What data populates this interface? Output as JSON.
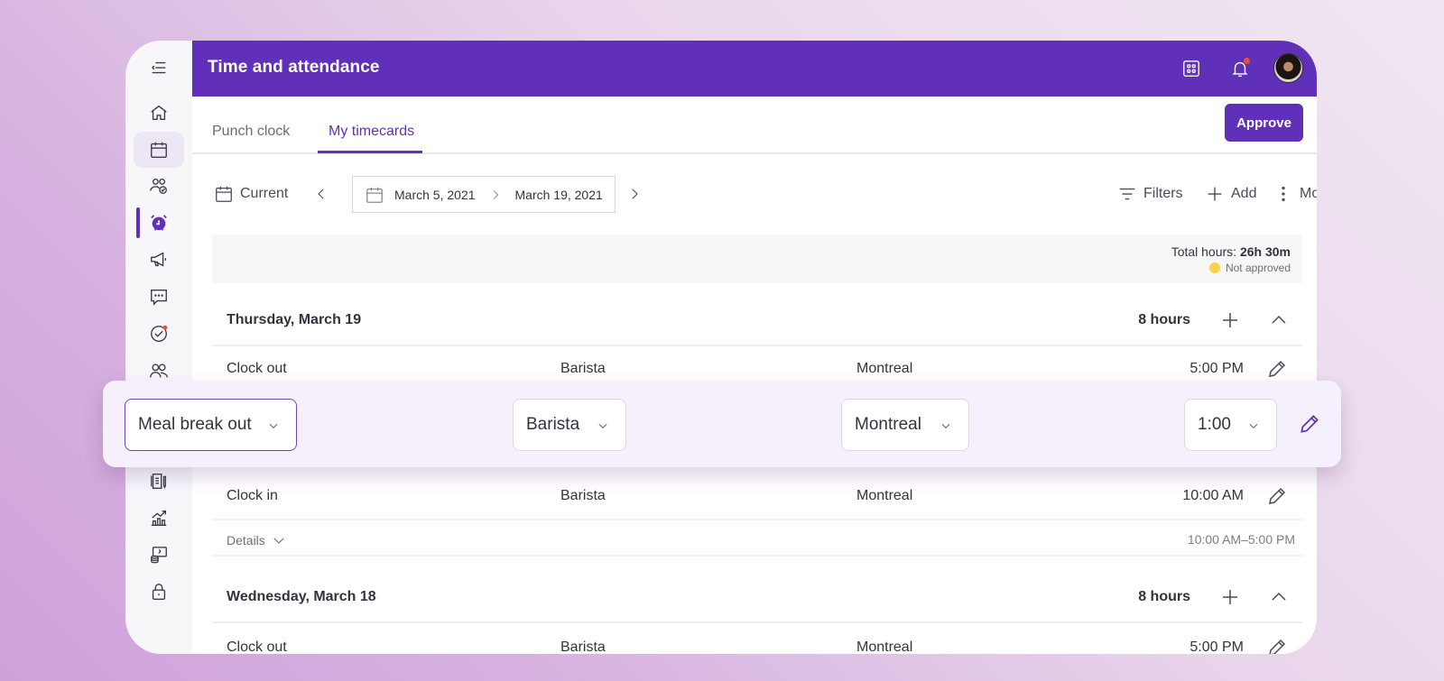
{
  "app": {
    "title": "Time and attendance"
  },
  "sidebar": {
    "items": [
      {
        "name": "menu-collapse",
        "icon": "menu-collapse-icon"
      },
      {
        "name": "home",
        "icon": "home-icon"
      },
      {
        "name": "calendar",
        "icon": "calendar-icon",
        "selected": true
      },
      {
        "name": "team-approval",
        "icon": "users-check-icon"
      },
      {
        "name": "time-attendance",
        "icon": "alarm-clock-icon",
        "active": true
      },
      {
        "name": "announcements",
        "icon": "megaphone-icon"
      },
      {
        "name": "messages",
        "icon": "chat-icon"
      },
      {
        "name": "tasks",
        "icon": "check-circle-icon",
        "badge": true
      },
      {
        "name": "people",
        "icon": "users-icon"
      },
      {
        "name": "documents",
        "icon": "document-icon"
      },
      {
        "name": "reports",
        "icon": "chart-icon"
      },
      {
        "name": "payroll",
        "icon": "money-icon"
      },
      {
        "name": "security",
        "icon": "lock-icon"
      }
    ]
  },
  "header": {
    "apps_icon": "grid-icon",
    "notifications_icon": "bell-icon",
    "has_notification": true,
    "avatar": "user-avatar"
  },
  "tabs": [
    {
      "label": "Punch clock",
      "active": false
    },
    {
      "label": "My timecards",
      "active": true
    }
  ],
  "approve_label": "Approve",
  "toolbar": {
    "current_label": "Current",
    "date_start": "March 5, 2021",
    "date_end": "March 19, 2021",
    "filters_label": "Filters",
    "add_label": "Add",
    "more_label": "More"
  },
  "summary": {
    "total_label": "Total hours:",
    "total_value": "26h 30m",
    "status": "Not approved",
    "status_color": "#f8d24e"
  },
  "days": [
    {
      "title": "Thursday, March 19",
      "hours": "8 hours",
      "entries": [
        {
          "type": "Clock out",
          "role": "Barista",
          "location": "Montreal",
          "time": "5:00 PM"
        },
        {
          "type": "Clock in",
          "role": "Barista",
          "location": "Montreal",
          "time": "10:00 AM"
        }
      ],
      "details_label": "Details",
      "range": "10:00 AM–5:00 PM"
    },
    {
      "title": "Wednesday, March 18",
      "hours": "8 hours",
      "entries": [
        {
          "type": "Clock out",
          "role": "Barista",
          "location": "Montreal",
          "time": "5:00 PM"
        }
      ]
    }
  ],
  "editing_row": {
    "type": "Meal break out",
    "role": "Barista",
    "location": "Montreal",
    "duration": "1:00"
  },
  "colors": {
    "brand": "#6130b8",
    "notification": "#ef4d3c"
  }
}
